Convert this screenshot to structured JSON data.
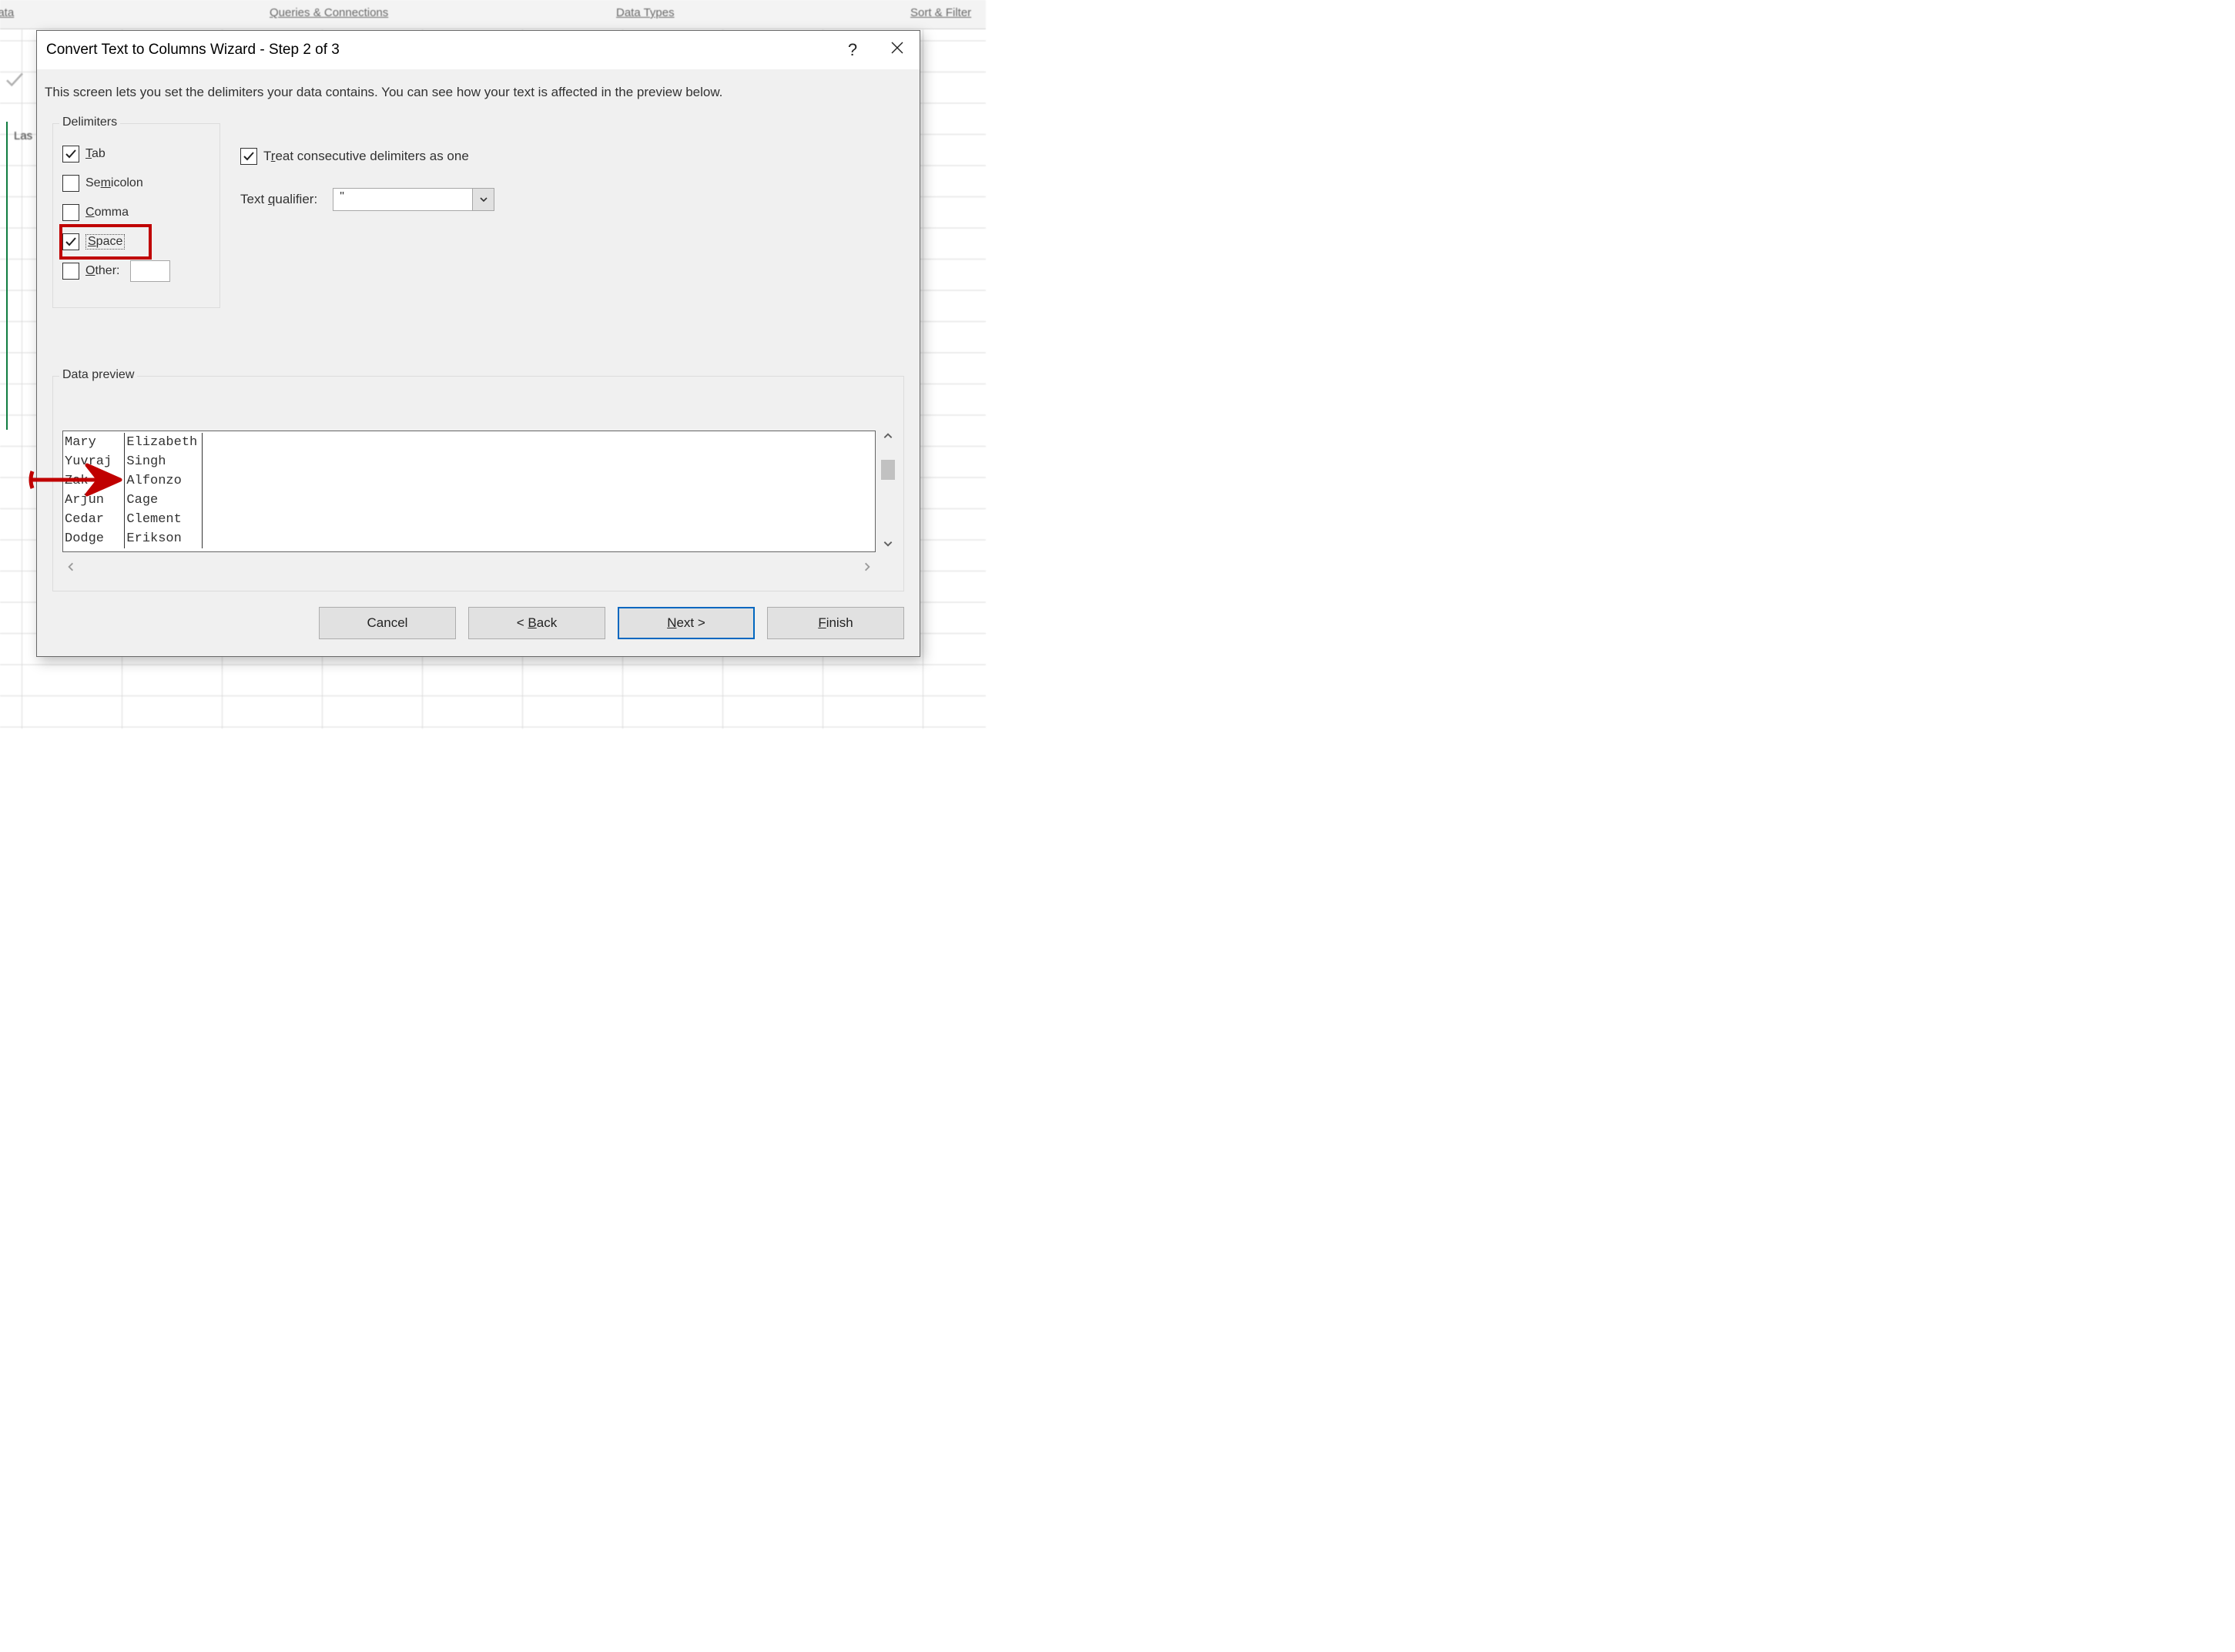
{
  "ribbon": {
    "group_data": "n Data",
    "group_queries": "Queries & Connections",
    "group_datatypes": "Data Types",
    "group_sortfilter": "Sort & Filter"
  },
  "sheet_bg": {
    "cell_text": "Las"
  },
  "dialog": {
    "title": "Convert Text to Columns Wizard - Step 2 of 3",
    "help_tooltip": "?",
    "instruction": "This screen lets you set the delimiters your data contains.  You can see how your text is affected in the preview below.",
    "delimiters": {
      "legend": "Delimiters",
      "tab": {
        "label_pre": "",
        "ul": "T",
        "label_post": "ab",
        "checked": true
      },
      "semicolon": {
        "label_pre": "Se",
        "ul": "m",
        "label_post": "icolon",
        "checked": false
      },
      "comma": {
        "label_pre": "",
        "ul": "C",
        "label_post": "omma",
        "checked": false
      },
      "space": {
        "label_pre": "",
        "ul": "S",
        "label_post": "pace",
        "checked": true
      },
      "other": {
        "label_pre": "",
        "ul": "O",
        "label_post": "ther:",
        "checked": false,
        "value": ""
      }
    },
    "consecutive": {
      "label_pre": "T",
      "ul": "r",
      "label_post": "eat consecutive delimiters as one",
      "checked": true
    },
    "text_qualifier": {
      "label_pre": "Text ",
      "ul": "q",
      "label_post": "ualifier:",
      "value": "\""
    },
    "preview": {
      "legend": "Data preview",
      "rows": [
        [
          "Mary",
          "Elizabeth"
        ],
        [
          "Yuvraj",
          "Singh"
        ],
        [
          "Zak",
          "Alfonzo"
        ],
        [
          "Arjun",
          "Cage"
        ],
        [
          "Cedar",
          "Clement"
        ],
        [
          "Dodge",
          "Erikson"
        ]
      ]
    },
    "buttons": {
      "cancel": "Cancel",
      "back_pre": "< ",
      "back_ul": "B",
      "back_post": "ack",
      "next_pre": "",
      "next_ul": "N",
      "next_post": "ext >",
      "finish_pre": "",
      "finish_ul": "F",
      "finish_post": "inish"
    }
  }
}
